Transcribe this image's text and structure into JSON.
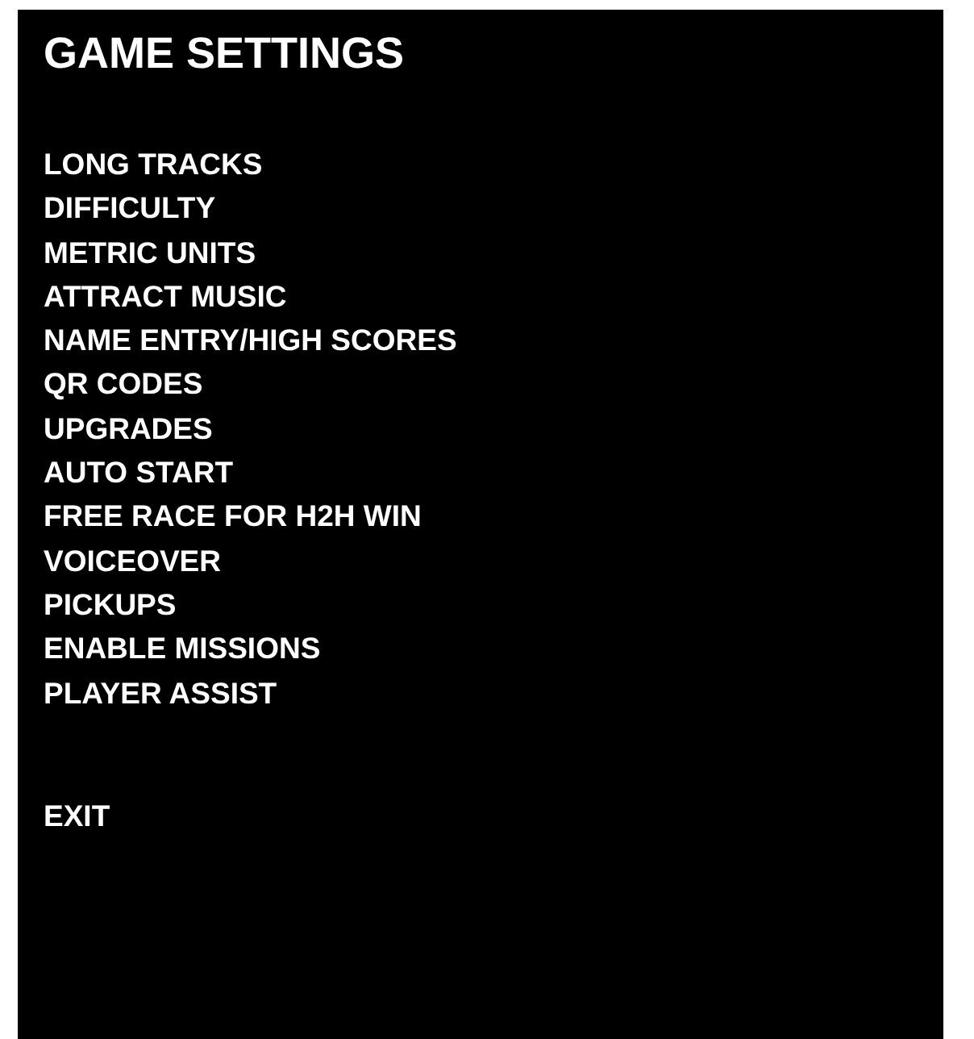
{
  "title": "GAME SETTINGS",
  "items": [
    {
      "label": "LONG TRACKS"
    },
    {
      "label": "DIFFICULTY"
    },
    {
      "label": "METRIC UNITS"
    },
    {
      "label": "ATTRACT MUSIC"
    },
    {
      "label": "NAME ENTRY/HIGH SCORES"
    },
    {
      "label": "QR CODES"
    },
    {
      "label": "UPGRADES"
    },
    {
      "label": "AUTO START"
    },
    {
      "label": "FREE RACE FOR H2H WIN"
    },
    {
      "label": "VOICEOVER"
    },
    {
      "label": "PICKUPS"
    },
    {
      "label": "ENABLE MISSIONS"
    },
    {
      "label": "PLAYER ASSIST"
    }
  ],
  "exit": "EXIT"
}
